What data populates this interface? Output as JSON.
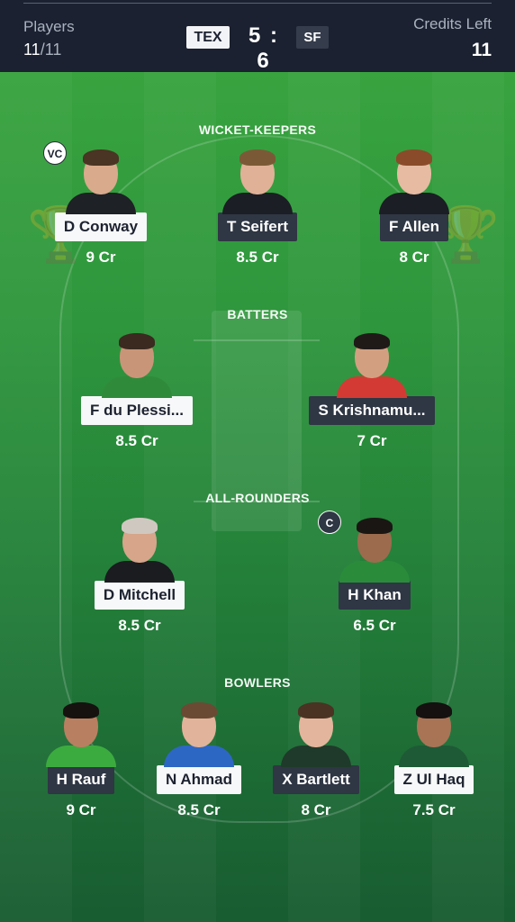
{
  "header": {
    "players_label": "Players",
    "players_count": "11",
    "players_total": "/11",
    "team_a": "TEX",
    "score": "5 : 6",
    "team_b": "SF",
    "credits_label": "Credits Left",
    "credits_value": "11"
  },
  "sections": {
    "wicket_keepers": "WICKET-KEEPERS",
    "batters": "BATTERS",
    "all_rounders": "ALL-ROUNDERS",
    "bowlers": "BOWLERS"
  },
  "badges": {
    "vice_captain": "VC",
    "captain": "C"
  },
  "players": {
    "conway": {
      "name": "D Conway",
      "credit": "9 Cr",
      "team_style": "light"
    },
    "seifert": {
      "name": "T Seifert",
      "credit": "8.5 Cr",
      "team_style": "dark"
    },
    "allen": {
      "name": "F Allen",
      "credit": "8 Cr",
      "team_style": "dark"
    },
    "duplessis": {
      "name": "F du Plessi...",
      "credit": "8.5 Cr",
      "team_style": "light"
    },
    "krishnamu": {
      "name": "S Krishnamu...",
      "credit": "7 Cr",
      "team_style": "dark"
    },
    "mitchell": {
      "name": "D Mitchell",
      "credit": "8.5 Cr",
      "team_style": "light"
    },
    "khan": {
      "name": "H Khan",
      "credit": "6.5 Cr",
      "team_style": "dark"
    },
    "rauf": {
      "name": "H Rauf",
      "credit": "9 Cr",
      "team_style": "dark"
    },
    "ahmad": {
      "name": "N Ahmad",
      "credit": "8.5 Cr",
      "team_style": "light"
    },
    "bartlett": {
      "name": "X Bartlett",
      "credit": "8 Cr",
      "team_style": "dark"
    },
    "ulhaq": {
      "name": "Z Ul Haq",
      "credit": "7.5 Cr",
      "team_style": "light"
    }
  }
}
